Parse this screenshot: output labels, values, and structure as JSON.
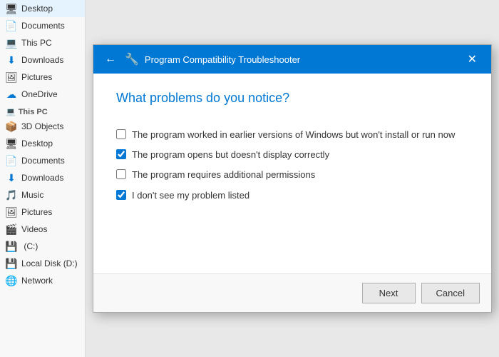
{
  "sidebar": {
    "quick_access": [
      {
        "id": "desktop",
        "label": "Desktop",
        "icon": "🖥"
      },
      {
        "id": "documents",
        "label": "Documents",
        "icon": "📄"
      },
      {
        "id": "this-pc",
        "label": "This PC",
        "icon": "💻"
      },
      {
        "id": "downloads",
        "label": "Downloads",
        "icon": "⬇"
      },
      {
        "id": "pictures",
        "label": "Pictures",
        "icon": "🖼"
      },
      {
        "id": "onedrive",
        "label": "OneDrive",
        "icon": "☁"
      }
    ],
    "this_pc": {
      "header": "This PC",
      "items": [
        {
          "id": "3d-objects",
          "label": "3D Objects",
          "icon": "📦"
        },
        {
          "id": "desktop2",
          "label": "Desktop",
          "icon": "🖥"
        },
        {
          "id": "documents2",
          "label": "Documents",
          "icon": "📄"
        },
        {
          "id": "downloads2",
          "label": "Downloads",
          "icon": "⬇"
        },
        {
          "id": "music",
          "label": "Music",
          "icon": "🎵"
        },
        {
          "id": "pictures2",
          "label": "Pictures",
          "icon": "🖼"
        },
        {
          "id": "videos",
          "label": "Videos",
          "icon": "🎬"
        },
        {
          "id": "c-drive",
          "label": ":C:",
          "icon": "💾"
        },
        {
          "id": "d-drive",
          "label": "Local Disk (D:)",
          "icon": "💾"
        }
      ]
    },
    "network": {
      "label": "Network",
      "icon": "🌐"
    }
  },
  "dialog": {
    "title": "Program Compatibility Troubleshooter",
    "question": "What problems do you notice?",
    "options": [
      {
        "id": "opt1",
        "label": "The program worked in earlier versions of Windows but won't install or run now",
        "checked": false
      },
      {
        "id": "opt2",
        "label": "The program opens but doesn't display correctly",
        "checked": true
      },
      {
        "id": "opt3",
        "label": "The program requires additional permissions",
        "checked": false
      },
      {
        "id": "opt4",
        "label": "I don't see my problem listed",
        "checked": true
      }
    ],
    "buttons": {
      "next": "Next",
      "cancel": "Cancel"
    }
  }
}
